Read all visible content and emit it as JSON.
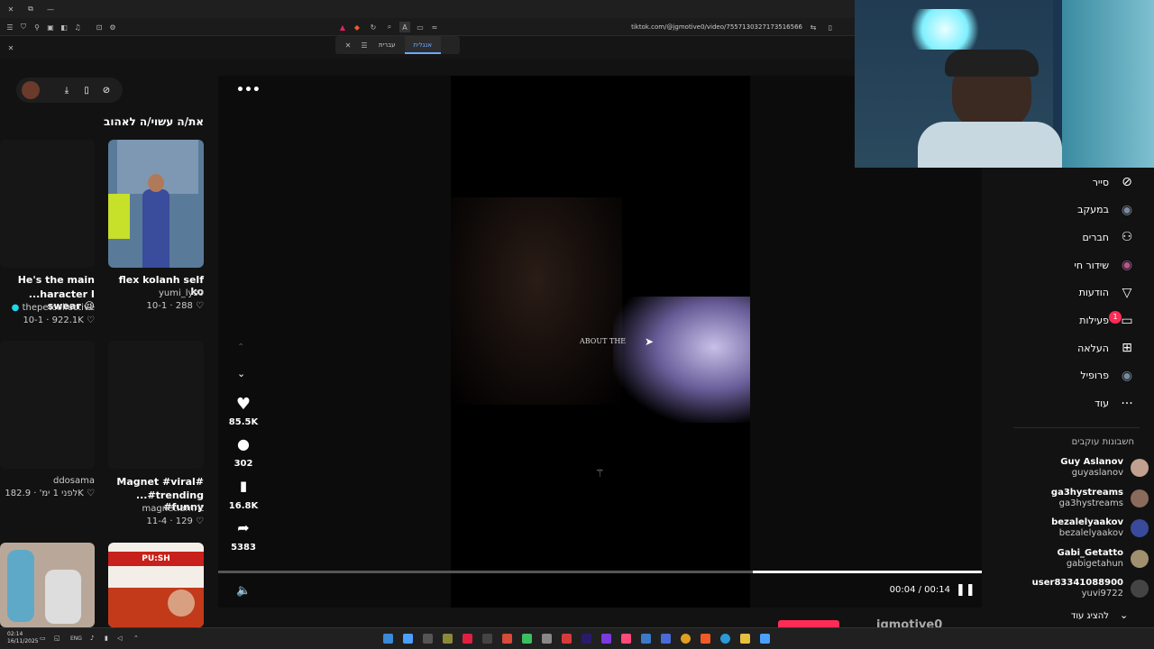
{
  "browser": {
    "url": "tiktok.com/@jgmotive0/video/7557130327173516566",
    "lang_tabs": [
      "עברית",
      "אנגלית"
    ],
    "active_lang_index": 1
  },
  "left_panel": {
    "section_title": "את/ה עשוי/ה לאהוב",
    "cards": [
      {
        "title": "flex kolanh self ko",
        "author": "yumi_lys0",
        "meta": "10-1 · 288 ♡"
      },
      {
        "title1": "He's the main",
        "title2": "...haracter I swear 😉",
        "author": "thepetcollective",
        "meta": "10-1 · 922.1K ♡"
      },
      {
        "title1": "Magnet #viral#",
        "title2": "...#trending #funny",
        "author": "magnet.amrit",
        "meta": "11-4 · 129 ♡"
      },
      {
        "author": "ddosama",
        "meta": "לפני 1 ימ' · 182.9K ♡"
      }
    ],
    "push_card_label": "PU:SH"
  },
  "video": {
    "overlay_text": "ABOUT THE",
    "time": "00:04 / 00:14",
    "progress_fraction": 0.3
  },
  "actions": {
    "likes": "85.5K",
    "comments": "302",
    "saves": "16.8K",
    "shares": "5383"
  },
  "bottom": {
    "username_partial": "jgmotive0"
  },
  "right_nav": {
    "items": [
      {
        "label": "סייר",
        "icon": "explore-icon"
      },
      {
        "label": "במעקב",
        "icon": "following-icon"
      },
      {
        "label": "חברים",
        "icon": "friends-icon"
      },
      {
        "label": "שידור חי",
        "icon": "live-icon"
      },
      {
        "label": "הודעות",
        "icon": "messages-icon"
      },
      {
        "label": "פעילות",
        "icon": "activity-icon"
      },
      {
        "label": "העלאה",
        "icon": "upload-icon"
      },
      {
        "label": "פרופיל",
        "icon": "profile-icon"
      },
      {
        "label": "עוד",
        "icon": "more-icon"
      }
    ],
    "activity_badge": "1",
    "following_title": "חשבונות עוקבים",
    "following": [
      {
        "name": "Guy Aslanov",
        "handle": "guyaslanov"
      },
      {
        "name": "ga3hystreams",
        "handle": "ga3hystreams"
      },
      {
        "name": "bezalelyaakov",
        "handle": "bezalelyaakov"
      },
      {
        "name": "Gabi_Getatto",
        "handle": "gabigetahun"
      },
      {
        "name": "user83341088900",
        "handle": "yuvi9722"
      }
    ],
    "show_more": "להציג עוד"
  },
  "taskbar": {
    "time": "02:14",
    "date": "16/11/2025",
    "lang": "ENG"
  }
}
